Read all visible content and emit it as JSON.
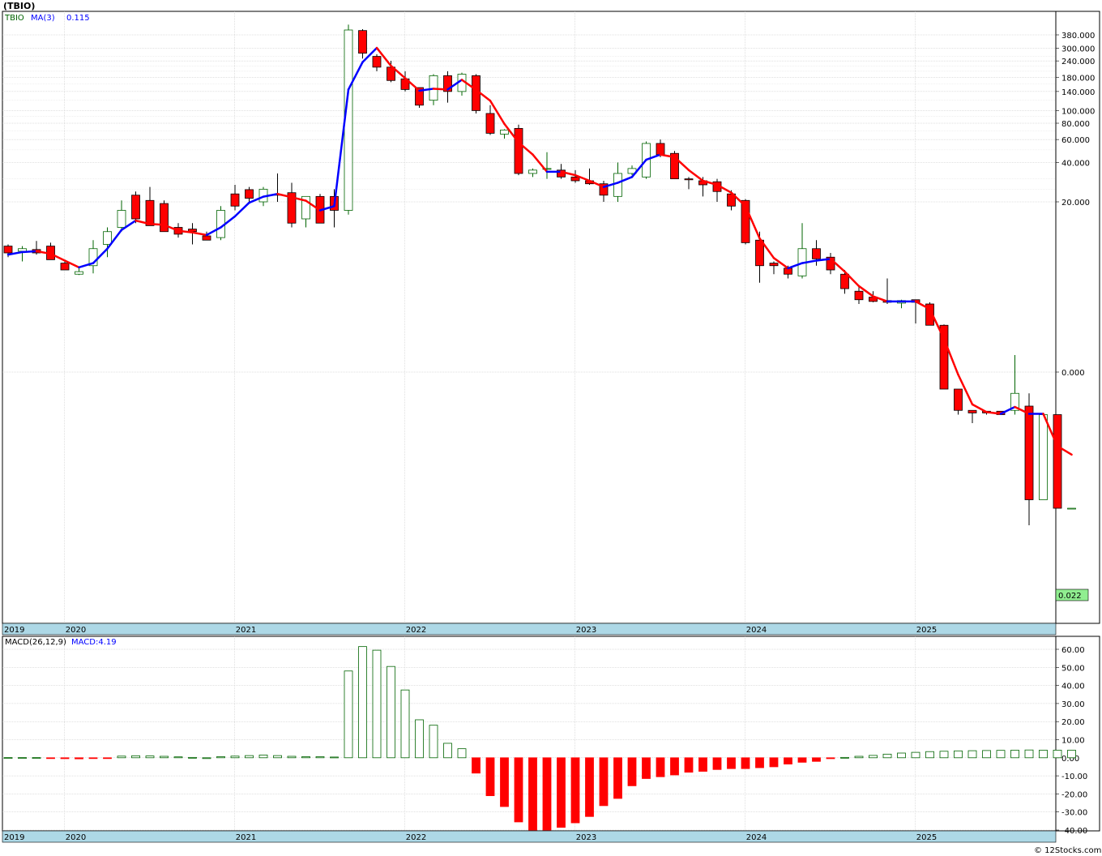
{
  "title": "(TBIO)",
  "legend_price": {
    "symbol": "TBIO",
    "ma_label": "MA(3)",
    "ma_value": "0.115"
  },
  "legend_macd": {
    "label": "MACD(26,12,9)",
    "value": "MACD:4.19"
  },
  "last_price_label": "0.022",
  "watermark": "© 12Stocks.com",
  "colors": {
    "up": "#006400",
    "down": "#ff0000",
    "ma_up": "#0000ff",
    "ma_down": "#ff0000",
    "axis_band": "#add8e6",
    "grid": "#c0c0c0"
  },
  "chart_data": [
    {
      "type": "candlestick",
      "name": "price",
      "title": "(TBIO)",
      "y_scale": "log-like (compressed below 20)",
      "y_ticks": [
        "380.000",
        "300.000",
        "240.000",
        "180.000",
        "140.000",
        "100.000",
        "80.000",
        "60.000",
        "40.000",
        "20.000",
        "0.000"
      ],
      "x_labels": [
        "2019",
        "2020",
        "2021",
        "2022",
        "2023",
        "2024",
        "2025"
      ],
      "grid": true,
      "note_candles": "[open, high, low, close] per month, Aug 2019 – Aug 2025",
      "candles": [
        [
          14.8,
          15.0,
          13.5,
          14.0
        ],
        [
          14.2,
          14.8,
          13.0,
          14.5
        ],
        [
          14.4,
          15.4,
          13.8,
          14.0
        ],
        [
          14.8,
          15.2,
          13.5,
          13.2
        ],
        [
          12.8,
          13.0,
          12.0,
          12.0
        ],
        [
          11.5,
          12.2,
          11.4,
          11.8
        ],
        [
          12.5,
          15.5,
          11.6,
          14.5
        ],
        [
          15.0,
          17.0,
          13.5,
          16.5
        ],
        [
          17.0,
          20.5,
          16.5,
          19.0
        ],
        [
          22.5,
          24.0,
          17.5,
          18.0
        ],
        [
          20.5,
          26.0,
          17.5,
          17.2
        ],
        [
          19.8,
          20.5,
          16.5,
          16.5
        ],
        [
          17.0,
          17.5,
          15.8,
          16.2
        ],
        [
          16.8,
          17.5,
          15.0,
          16.5
        ],
        [
          16.0,
          16.5,
          15.5,
          15.5
        ],
        [
          15.8,
          19.5,
          15.5,
          19.0
        ],
        [
          23.0,
          27.0,
          19.0,
          19.5
        ],
        [
          24.8,
          26.0,
          20.0,
          21.3
        ],
        [
          20.0,
          26.0,
          19.5,
          25.0
        ],
        [
          22.8,
          33.0,
          20.0,
          22.7
        ],
        [
          23.5,
          28.0,
          17.0,
          17.5
        ],
        [
          18.0,
          21.5,
          17.0,
          22.0
        ],
        [
          22.0,
          23.0,
          17.5,
          17.5
        ],
        [
          22.0,
          25.0,
          17.0,
          19.0
        ],
        [
          19.0,
          455.0,
          18.5,
          414.0
        ],
        [
          410.0,
          420.0,
          250.0,
          275.0
        ],
        [
          260.0,
          270.0,
          200.0,
          215.0
        ],
        [
          215.0,
          240.0,
          165.0,
          170.0
        ],
        [
          175.0,
          200.0,
          140.0,
          145.0
        ],
        [
          150.0,
          145.0,
          105.0,
          110.0
        ],
        [
          120.0,
          190.0,
          110.0,
          185.0
        ],
        [
          185.0,
          200.0,
          115.0,
          140.0
        ],
        [
          140.0,
          195.0,
          130.0,
          190.0
        ],
        [
          185.0,
          190.0,
          95.0,
          100.0
        ],
        [
          95.0,
          110.0,
          65.0,
          67.0
        ],
        [
          66.0,
          72.0,
          61.0,
          71.0
        ],
        [
          73.0,
          78.0,
          32.0,
          33.0
        ],
        [
          33.0,
          36.0,
          31.0,
          35.0
        ],
        [
          36.0,
          48.0,
          30.0,
          36.0
        ],
        [
          35.0,
          39.0,
          30.0,
          31.0
        ],
        [
          31.0,
          35.0,
          28.0,
          29.0
        ],
        [
          29.0,
          36.0,
          27.0,
          27.5
        ],
        [
          27.5,
          29.0,
          20.0,
          22.5
        ],
        [
          22.0,
          40.0,
          20.0,
          33.0
        ],
        [
          33.0,
          38.0,
          32.0,
          36.0
        ],
        [
          31.0,
          58.0,
          30.0,
          56.0
        ],
        [
          56.0,
          60.0,
          44.0,
          46.0
        ],
        [
          47.0,
          49.0,
          30.0,
          30.0
        ],
        [
          30.0,
          31.0,
          25.0,
          29.5
        ],
        [
          29.0,
          31.0,
          22.0,
          27.0
        ],
        [
          28.5,
          30.0,
          20.0,
          24.0
        ],
        [
          23.0,
          24.5,
          19.0,
          19.5
        ],
        [
          20.5,
          21.0,
          15.0,
          15.2
        ],
        [
          15.5,
          16.5,
          10.5,
          12.5
        ],
        [
          12.8,
          13.0,
          11.5,
          12.5
        ],
        [
          12.2,
          12.5,
          11.0,
          11.5
        ],
        [
          11.3,
          17.5,
          11.0,
          14.5
        ],
        [
          14.5,
          15.5,
          12.5,
          13.3
        ],
        [
          13.5,
          14.0,
          11.5,
          12.0
        ],
        [
          11.5,
          12.0,
          9.2,
          9.8
        ],
        [
          9.5,
          10.0,
          8.0,
          8.5
        ],
        [
          8.8,
          9.5,
          8.2,
          8.3
        ],
        [
          8.4,
          11.0,
          8.0,
          8.2
        ],
        [
          8.1,
          8.5,
          7.5,
          8.4
        ],
        [
          8.5,
          8.5,
          5.7,
          8.2
        ],
        [
          8.0,
          8.2,
          5.5,
          5.5
        ],
        [
          5.5,
          5.6,
          -2.0,
          -2.0
        ],
        [
          -2.0,
          -2.0,
          -5.0,
          -4.5
        ],
        [
          -4.5,
          -4.5,
          -6.0,
          -4.8
        ],
        [
          -4.6,
          -4.6,
          -5.0,
          -4.8
        ],
        [
          -4.6,
          -4.6,
          -5.0,
          -5.0
        ],
        [
          -4.5,
          2.0,
          -5.0,
          -2.5
        ],
        [
          -4.0,
          -2.5,
          -18.0,
          -15.0
        ],
        [
          -15.0,
          -5.0,
          -15.0,
          -5.0
        ],
        [
          -5.0,
          -5.0,
          -16.0,
          -16.0
        ],
        [
          -16.0,
          -16.0,
          -16.0,
          -16.0
        ]
      ],
      "ma3": [
        13.8,
        14.1,
        14.2,
        13.9,
        13.1,
        12.3,
        12.8,
        14.5,
        16.7,
        17.8,
        17.4,
        17.3,
        16.6,
        16.4,
        16.1,
        17.0,
        18.3,
        19.9,
        21.9,
        23.0,
        21.7,
        20.4,
        19.0,
        19.5,
        145.0,
        235.0,
        302.0,
        220.0,
        177.0,
        142.0,
        147.0,
        145.0,
        172.0,
        144.0,
        119.0,
        79.0,
        57.0,
        46.0,
        34.0,
        34.0,
        32.0,
        29.0,
        26.0,
        28.0,
        31.0,
        42.0,
        46.0,
        44.0,
        35.0,
        29.0,
        27.0,
        23.5,
        19.5,
        15.7,
        13.4,
        12.2,
        12.8,
        13.1,
        13.3,
        11.8,
        10.1,
        8.9,
        8.3,
        8.3,
        8.3,
        7.4,
        3.9,
        -0.3,
        -3.8,
        -4.7,
        -4.9,
        -4.1,
        -4.9,
        -4.9,
        -8.7,
        -9.7
      ],
      "last_label": "0.022"
    },
    {
      "type": "bar",
      "name": "macd",
      "title": "MACD(26,12,9)",
      "y_ticks": [
        "60.00",
        "50.00",
        "40.00",
        "30.00",
        "20.00",
        "10.00",
        "0.00",
        "-10.00",
        "-20.00",
        "-30.00",
        "-40.00"
      ],
      "ylim": [
        -40,
        60
      ],
      "x_labels": [
        "2019",
        "2020",
        "2021",
        "2022",
        "2023",
        "2024",
        "2025"
      ],
      "values": [
        0.1,
        0.1,
        0.1,
        -0.3,
        -0.5,
        -0.6,
        -0.4,
        -0.3,
        0.9,
        1.1,
        1.0,
        0.8,
        0.5,
        0.2,
        0.0,
        0.6,
        0.9,
        1.2,
        1.5,
        1.2,
        0.8,
        0.6,
        0.6,
        0.4,
        48.0,
        61.5,
        59.5,
        50.5,
        37.5,
        21.0,
        18.0,
        8.0,
        5.0,
        -8.5,
        -21.0,
        -27.0,
        -35.5,
        -40.0,
        -40.0,
        -38.5,
        -36.0,
        -32.5,
        -26.5,
        -22.5,
        -15.5,
        -11.5,
        -10.5,
        -9.5,
        -8.0,
        -7.5,
        -6.5,
        -6.0,
        -6.0,
        -5.5,
        -5.0,
        -3.5,
        -2.5,
        -2.0,
        -0.5,
        0.2,
        0.8,
        1.3,
        2.0,
        2.6,
        3.0,
        3.4,
        3.6,
        3.8,
        3.9,
        4.0,
        4.1,
        4.2,
        4.3,
        4.2,
        4.2,
        4.19
      ]
    }
  ]
}
